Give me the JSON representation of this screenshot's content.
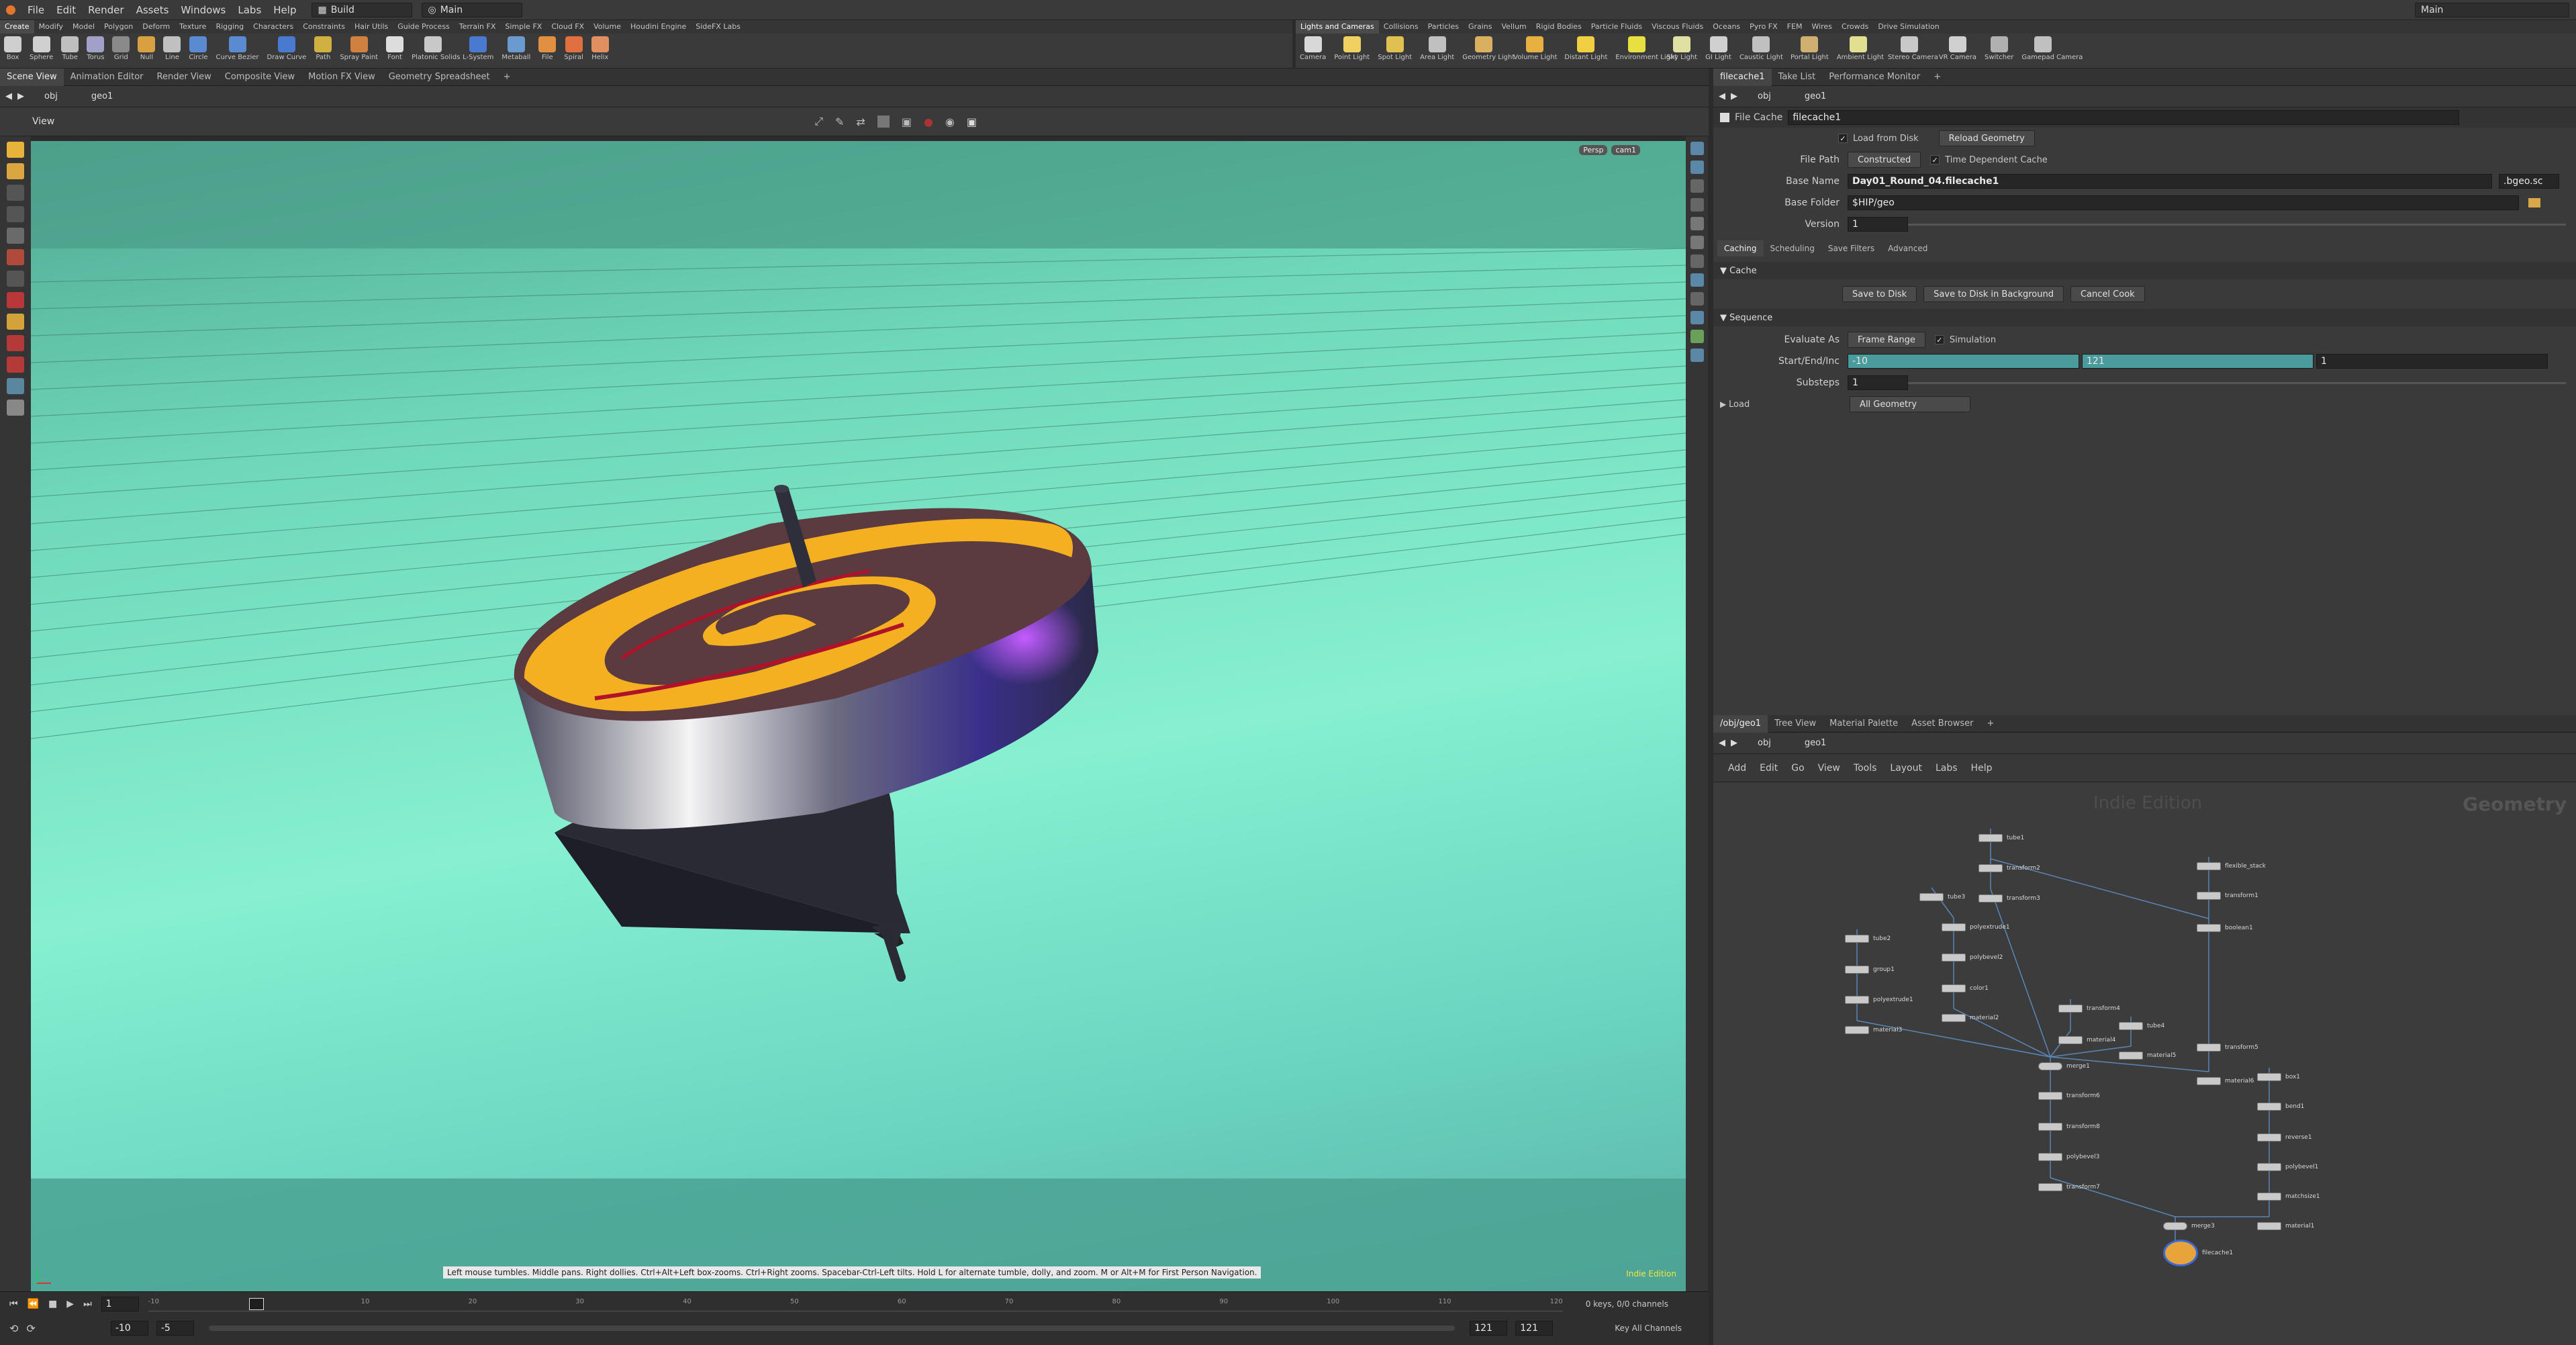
{
  "menubar": {
    "items": [
      "File",
      "Edit",
      "Render",
      "Assets",
      "Windows",
      "Labs",
      "Help"
    ],
    "desktop": "Build",
    "context": "Main",
    "right_context": "Main"
  },
  "shelf": {
    "tabs_left": [
      "Create",
      "Modify",
      "Model",
      "Polygon",
      "Deform",
      "Texture",
      "Rigging",
      "Characters",
      "Constraints",
      "Hair Utils",
      "Guide Process",
      "Terrain FX",
      "Simple FX",
      "Cloud FX",
      "Volume",
      "Houdini Engine",
      "SideFX Labs"
    ],
    "tabs_right": [
      "Lights and Cameras",
      "Collisions",
      "Particles",
      "Grains",
      "Vellum",
      "Rigid Bodies",
      "Particle Fluids",
      "Viscous Fluids",
      "Oceans",
      "Pyro FX",
      "FEM",
      "Wires",
      "Crowds",
      "Drive Simulation"
    ],
    "tools_left": [
      "Box",
      "Sphere",
      "Tube",
      "Torus",
      "Grid",
      "Null",
      "Line",
      "Circle",
      "Curve Bezier",
      "Draw Curve",
      "Path",
      "Spray Paint",
      "Font",
      "Platonic Solids",
      "L-System",
      "Metaball",
      "File",
      "Spiral",
      "Helix"
    ],
    "tools_right": [
      "Camera",
      "Point Light",
      "Spot Light",
      "Area Light",
      "Geometry Light",
      "Volume Light",
      "Distant Light",
      "Environment Light",
      "Sky Light",
      "GI Light",
      "Caustic Light",
      "Portal Light",
      "Ambient Light",
      "Stereo Camera",
      "VR Camera",
      "Switcher",
      "Gamepad Camera"
    ]
  },
  "left_tabs": [
    "Scene View",
    "Animation Editor",
    "Render View",
    "Composite View",
    "Motion FX View",
    "Geometry Spreadsheet"
  ],
  "path": {
    "obj": "obj",
    "geo": "geo1"
  },
  "viewport": {
    "title": "View",
    "persp": "Persp",
    "cam": "cam1",
    "status": "Left mouse tumbles. Middle pans. Right dollies. Ctrl+Alt+Left box-zooms. Ctrl+Right zooms. Spacebar-Ctrl-Left tilts. Hold L for alternate tumble, dolly, and zoom.    M or Alt+M for First Person Navigation.",
    "edition": "Indie Edition"
  },
  "timeline": {
    "frame": "1",
    "start": "-10",
    "start2": "-5",
    "end": "121",
    "end2": "121",
    "keys": "0 keys, 0/0 channels",
    "key_all": "Key All Channels",
    "ticks": [
      "-10",
      "0",
      "10",
      "20",
      "30",
      "40",
      "50",
      "60",
      "70",
      "80",
      "90",
      "100",
      "110",
      "120"
    ]
  },
  "right_tabs": [
    "filecache1",
    "Take List",
    "Performance Monitor"
  ],
  "params": {
    "node_type": "File Cache",
    "node_name": "filecache1",
    "load_from_disk": "Load from Disk",
    "reload": "Reload Geometry",
    "file_path_label": "File Path",
    "file_path_mode": "Constructed",
    "time_dep": "Time Dependent Cache",
    "base_name_label": "Base Name",
    "base_name": "Day01_Round_04.filecache1",
    "ext": ".bgeo.sc",
    "base_folder_label": "Base Folder",
    "base_folder": "$HIP/geo",
    "version_label": "Version",
    "version": "1",
    "tabs": [
      "Caching",
      "Scheduling",
      "Save Filters",
      "Advanced"
    ],
    "cache_section": "Cache",
    "save_disk": "Save to Disk",
    "save_bg": "Save to Disk in Background",
    "cancel": "Cancel Cook",
    "seq_section": "Sequence",
    "eval_label": "Evaluate As",
    "eval_val": "Frame Range",
    "simulation": "Simulation",
    "range_label": "Start/End/Inc",
    "range_start": "-10",
    "range_end": "121",
    "range_inc": "1",
    "substeps_label": "Substeps",
    "substeps": "1",
    "load_section": "Load",
    "load_val": "All Geometry"
  },
  "net": {
    "tabs": [
      "/obj/geo1",
      "Tree View",
      "Material Palette",
      "Asset Browser"
    ],
    "menu": [
      "Add",
      "Edit",
      "Go",
      "View",
      "Tools",
      "Layout",
      "Labs",
      "Help"
    ],
    "watermark": "Indie Edition",
    "context": "Geometry",
    "nodes": [
      {
        "n": "tube1"
      },
      {
        "n": "transform2"
      },
      {
        "n": "tube3"
      },
      {
        "n": "transform3"
      },
      {
        "n": "polyextrude1"
      },
      {
        "n": "merge2"
      },
      {
        "n": "flexible_stack"
      },
      {
        "n": "transform1"
      },
      {
        "n": "boolean1"
      },
      {
        "n": "polybevel2"
      },
      {
        "n": "color1"
      },
      {
        "n": "material2"
      },
      {
        "n": "tube2"
      },
      {
        "n": "group1"
      },
      {
        "n": "polyextrude1"
      },
      {
        "n": "material3"
      },
      {
        "n": "transform4"
      },
      {
        "n": "material4"
      },
      {
        "n": "tube4"
      },
      {
        "n": "material5"
      },
      {
        "n": "transform5"
      },
      {
        "n": "material6"
      },
      {
        "n": "merge1"
      },
      {
        "n": "transform6"
      },
      {
        "n": "transform8"
      },
      {
        "n": "polybevel3"
      },
      {
        "n": "transform7"
      },
      {
        "n": "box1"
      },
      {
        "n": "bend1"
      },
      {
        "n": "reverse1"
      },
      {
        "n": "polybevel1"
      },
      {
        "n": "matchsize1"
      },
      {
        "n": "material1"
      },
      {
        "n": "merge3"
      },
      {
        "n": "filecache1"
      }
    ]
  }
}
